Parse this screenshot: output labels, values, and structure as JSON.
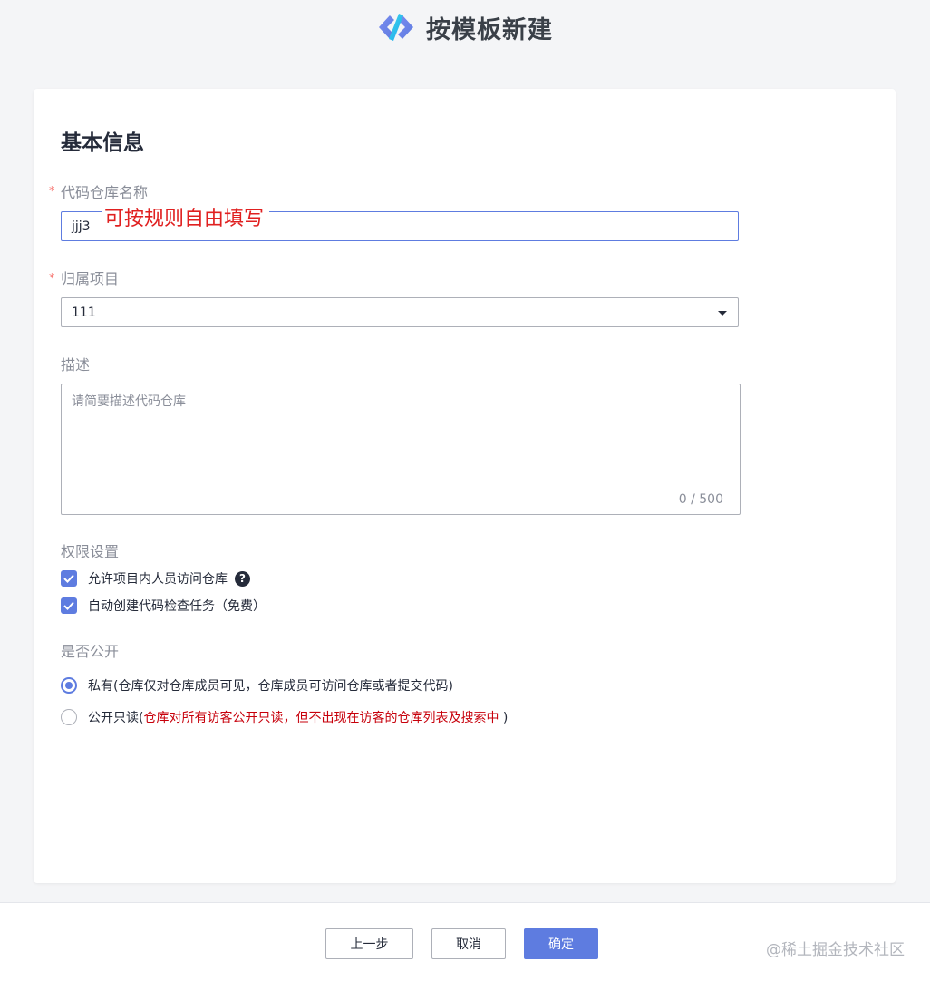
{
  "header": {
    "title": "按模板新建"
  },
  "section": {
    "title": "基本信息"
  },
  "repo_name": {
    "label": "代码仓库名称",
    "value": "jjj3",
    "annotation": "可按规则自由填写"
  },
  "project": {
    "label": "归属项目",
    "value": "111"
  },
  "description": {
    "label": "描述",
    "placeholder": "请简要描述代码仓库",
    "counter": "0 / 500"
  },
  "permissions": {
    "label": "权限设置",
    "options": [
      {
        "label": "允许项目内人员访问仓库",
        "checked": true
      },
      {
        "label": "自动创建代码检查任务（免费）",
        "checked": true
      }
    ]
  },
  "visibility": {
    "label": "是否公开",
    "private_label": "私有(仓库仅对仓库成员可见，仓库成员可访问仓库或者提交代码)",
    "public_prefix": "公开只读(",
    "public_note": "仓库对所有访客公开只读，但不出现在访客的仓库列表及搜索中",
    "public_suffix": " )"
  },
  "footer": {
    "prev_label": "上一步",
    "cancel_label": "取消",
    "confirm_label": "确定"
  },
  "watermark": "@稀土掘金技术社区",
  "colors": {
    "primary": "#5e7ce0",
    "required": "#f66f6a",
    "annotation": "#e02020",
    "note_red": "#c7000b"
  }
}
